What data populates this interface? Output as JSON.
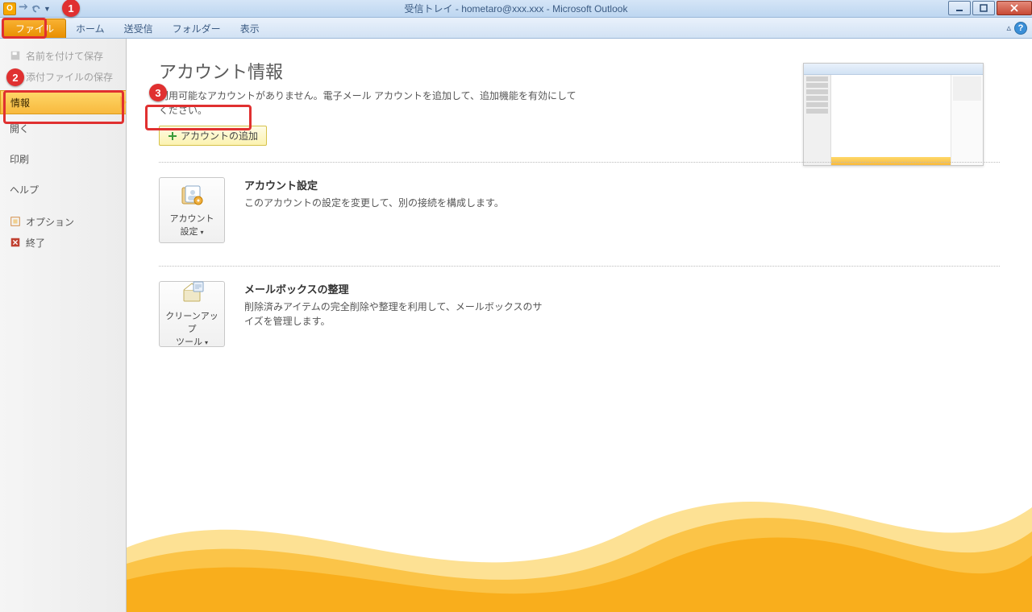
{
  "titlebar": {
    "title": "受信トレイ - hometaro@xxx.xxx - Microsoft Outlook"
  },
  "ribbon_tabs": {
    "file": "ファイル",
    "home": "ホーム",
    "send_receive": "送受信",
    "folder": "フォルダー",
    "view": "表示"
  },
  "backstage_sidebar": {
    "save_as": "名前を付けて保存",
    "save_attachments": "添付ファイルの保存",
    "info": "情報",
    "open": "開く",
    "print": "印刷",
    "help": "ヘルプ",
    "options": "オプション",
    "exit": "終了"
  },
  "content": {
    "heading": "アカウント情報",
    "description": "利用可能なアカウントがありません。電子メール アカウントを追加して、追加機能を有効にしてください。",
    "add_account_btn": "アカウントの追加",
    "account_settings": {
      "title": "アカウント設定",
      "body": "このアカウントの設定を変更して、別の接続を構成します。",
      "btn_label_l1": "アカウント",
      "btn_label_l2": "設定"
    },
    "cleanup": {
      "title": "メールボックスの整理",
      "body": "削除済みアイテムの完全削除や整理を利用して、メールボックスのサイズを管理します。",
      "btn_label_l1": "クリーンアップ",
      "btn_label_l2": "ツール"
    }
  },
  "callouts": {
    "c1": "1",
    "c2": "2",
    "c3": "3"
  }
}
